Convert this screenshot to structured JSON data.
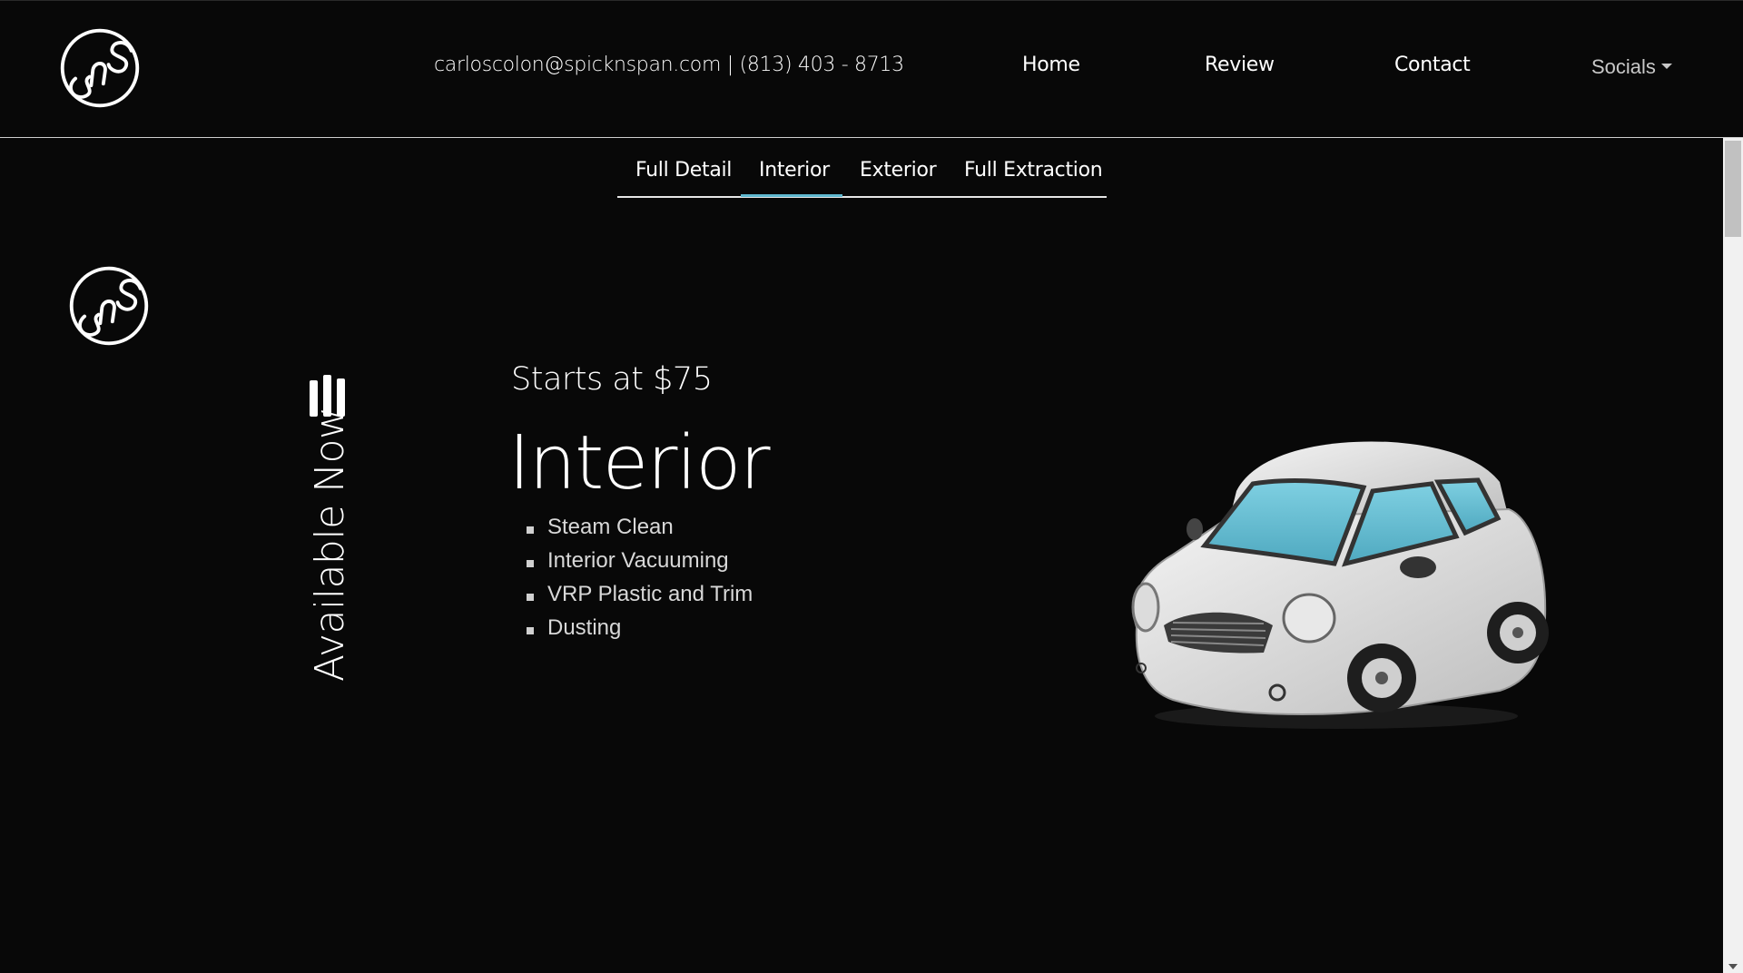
{
  "navbar": {
    "contact_info": "carloscolon@spicknspan.com | (813) 403 - 8713",
    "links": [
      "Home",
      "Review",
      "Contact"
    ],
    "socials_label": "Socials"
  },
  "tabs": {
    "items": [
      "Full Detail",
      "Interior",
      "Exterior",
      "Full Extraction"
    ],
    "active": "Interior",
    "accent_color": "#5fb8cf"
  },
  "service": {
    "availability": "Available Now",
    "price": "Starts at $75",
    "title": "Interior",
    "features": [
      "Steam Clean",
      "Interior Vacuuming",
      "VRP Plastic and Trim",
      "Dusting"
    ]
  },
  "theme": {
    "background": "#080808",
    "text": "#ffffff",
    "car_window_color": "#6cc4d8"
  },
  "icons": [
    "sns-logo-icon",
    "signal-bars-icon",
    "caret-down-icon",
    "car-image"
  ]
}
